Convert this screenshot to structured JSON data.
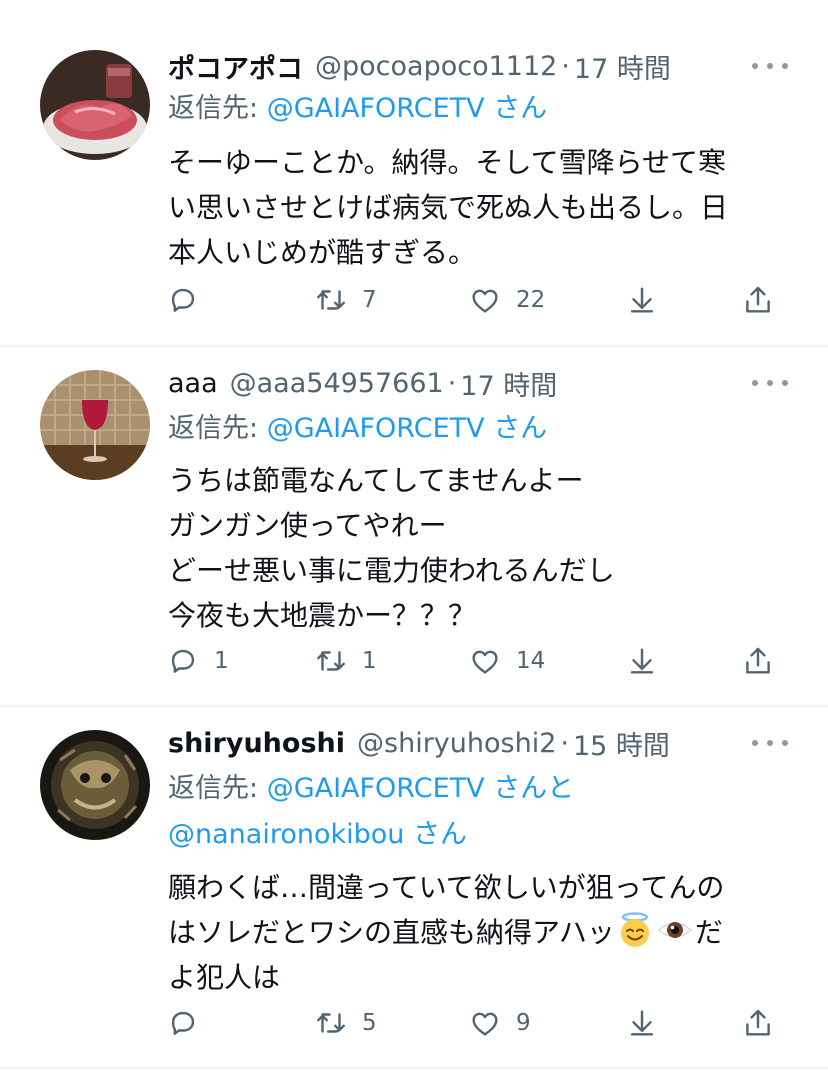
{
  "tweets": [
    {
      "name": "ポコアポコ",
      "handle": "@pocoapoco1112",
      "dot": "·",
      "time": "17 時間",
      "reply_prefix": "返信先: ",
      "reply_mentions": [
        "@GAIAFORCETV",
        "さん"
      ],
      "text_lines": [
        "そーゆーことか。納得。そして雪降らせて寒",
        "い思いさせとけば病気で死ぬ人も出るし。日",
        "本人いじめが酷すぎる。"
      ],
      "replies": "",
      "retweets": "7",
      "likes": "22"
    },
    {
      "name": "aaa",
      "handle": "@aaa54957661",
      "dot": "·",
      "time": "17 時間",
      "reply_prefix": "返信先: ",
      "reply_mentions": [
        "@GAIAFORCETV",
        "さん"
      ],
      "text_lines": [
        "うちは節電なんてしてませんよー",
        "ガンガン使ってやれー",
        "どーせ悪い事に電力使われるんだし",
        "今夜も大地震かー？？？"
      ],
      "replies": "1",
      "retweets": "1",
      "likes": "14"
    },
    {
      "name": "shiryuhoshi",
      "handle": "@shiryuhoshi2",
      "dot": "·",
      "time": "15 時間",
      "reply_prefix": "返信先: ",
      "reply_mentions": [
        "@GAIAFORCETV",
        "さんと",
        "@nanaironokibou",
        "さん"
      ],
      "text_lines": [
        "願わくば…間違っていて欲しいが狙ってんの",
        "はソレだとワシの直感も納得アハッ",
        "だ",
        "よ犯人は"
      ],
      "replies": "",
      "retweets": "5",
      "likes": "9"
    }
  ],
  "icons": {
    "more": "more-horizontal-icon",
    "reply": "reply-icon",
    "retweet": "retweet-icon",
    "like": "like-icon",
    "download": "download-icon",
    "share": "share-icon",
    "emojis": [
      "smiling-face-with-halo-emoji",
      "eye-emoji"
    ]
  },
  "colors": {
    "link": "#1d9bf0",
    "muted": "#536471",
    "text": "#0f1419",
    "divider": "#eff3f4"
  }
}
